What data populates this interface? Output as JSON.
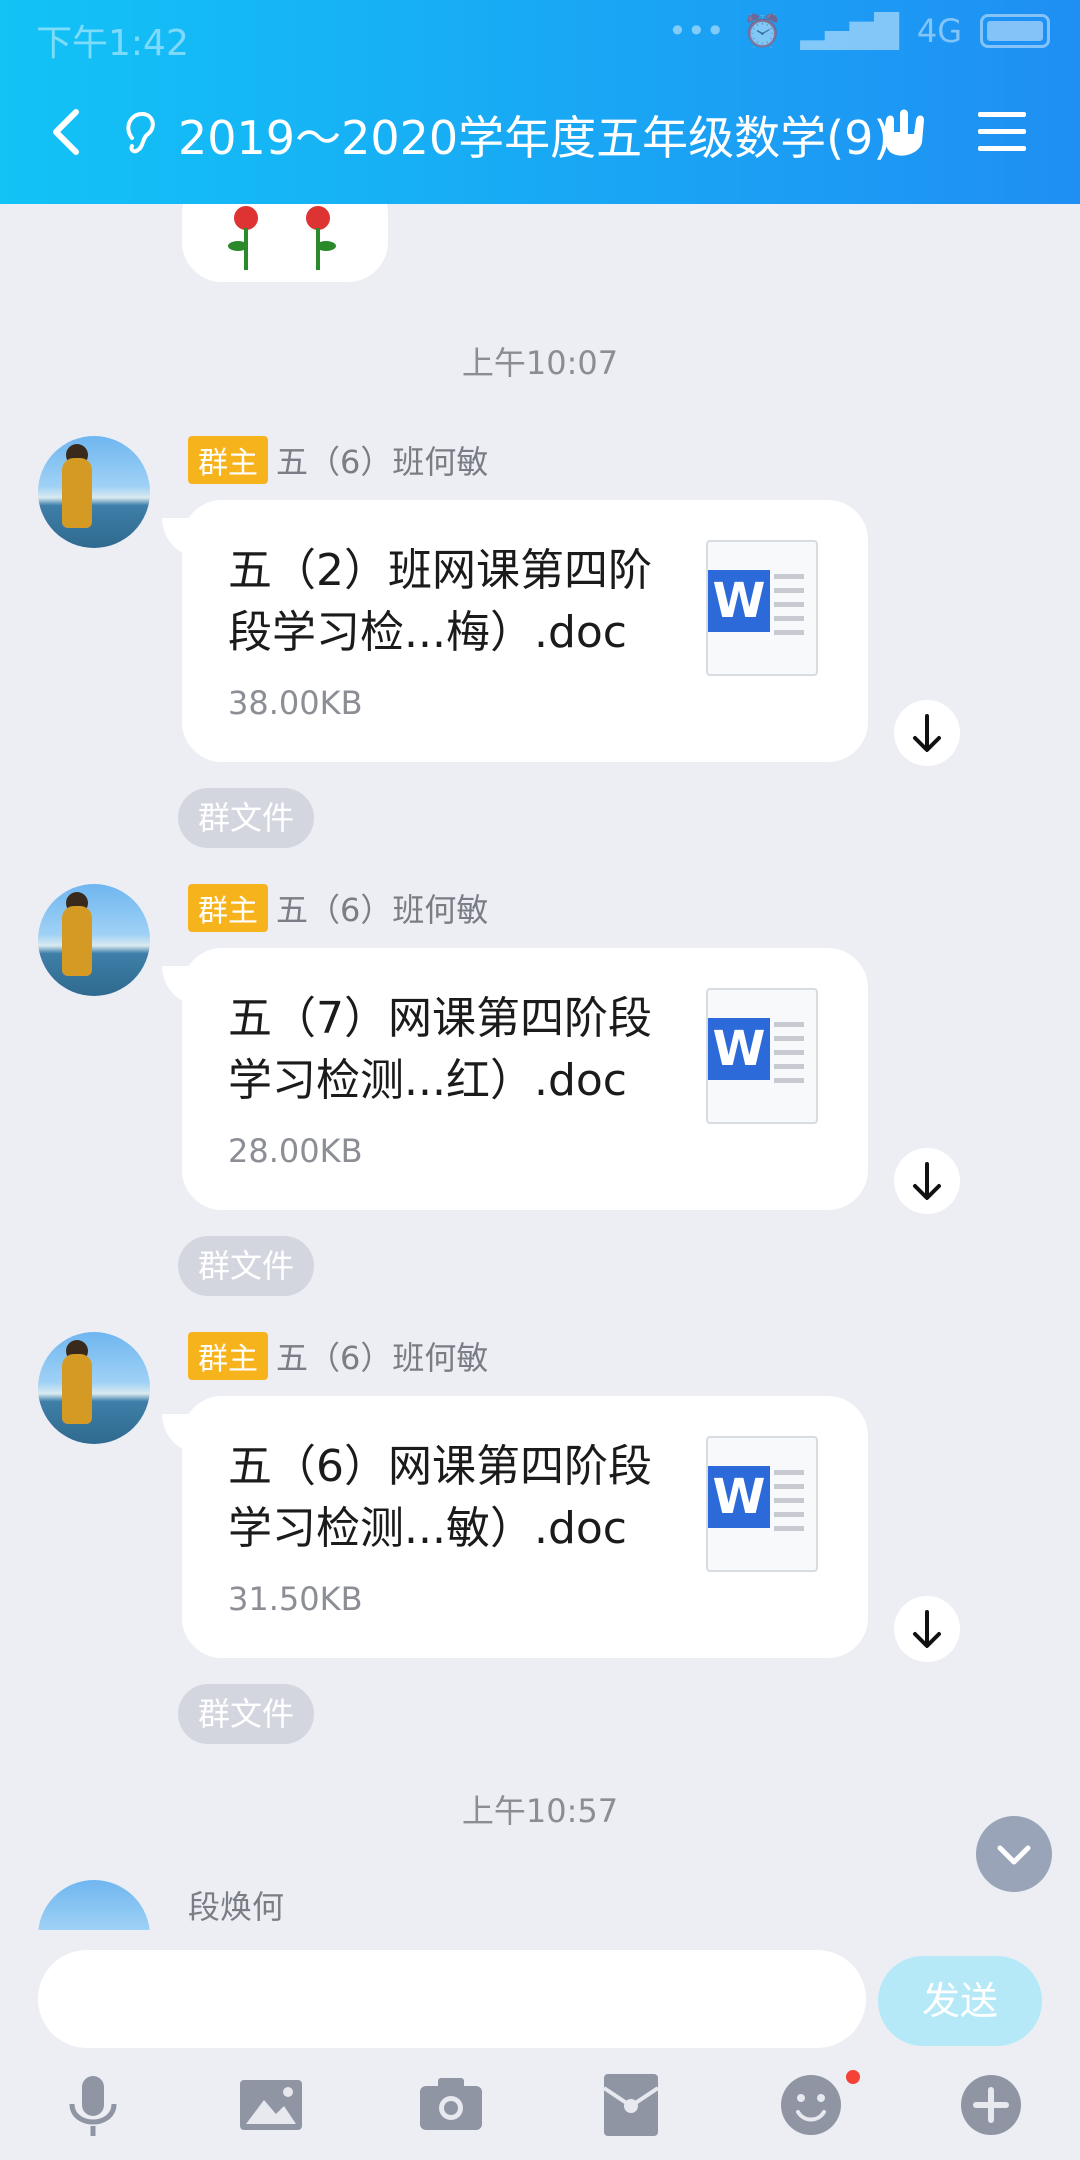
{
  "status_bar": {
    "time": "下午1:42",
    "network": "4G"
  },
  "header": {
    "title": "2019～2020学年度五年级数学(9)"
  },
  "timestamps": [
    "上午10:07",
    "上午10:57"
  ],
  "messages": [
    {
      "badge": "群主",
      "sender": "五（6）班何敏",
      "file_name": "五（2）班网课第四阶段学习检...梅）.doc",
      "file_size": "38.00KB",
      "tag": "群文件"
    },
    {
      "badge": "群主",
      "sender": "五（6）班何敏",
      "file_name": "五（7）网课第四阶段学习检测...红）.doc",
      "file_size": "28.00KB",
      "tag": "群文件"
    },
    {
      "badge": "群主",
      "sender": "五（6）班何敏",
      "file_name": "五（6）网课第四阶段学习检测...敏）.doc",
      "file_size": "31.50KB",
      "tag": "群文件"
    }
  ],
  "next_sender": "段焕何",
  "input": {
    "send_label": "发送"
  },
  "toolbar": [
    "microphone-icon",
    "image-icon",
    "camera-icon",
    "red-packet-icon",
    "emoji-icon",
    "plus-icon"
  ],
  "colors": {
    "header_start": "#12c3f6",
    "header_end": "#1f8ff3",
    "badge": "#f7b31b",
    "send_disabled": "#b5e9f8",
    "word_blue": "#2d6ad9"
  }
}
